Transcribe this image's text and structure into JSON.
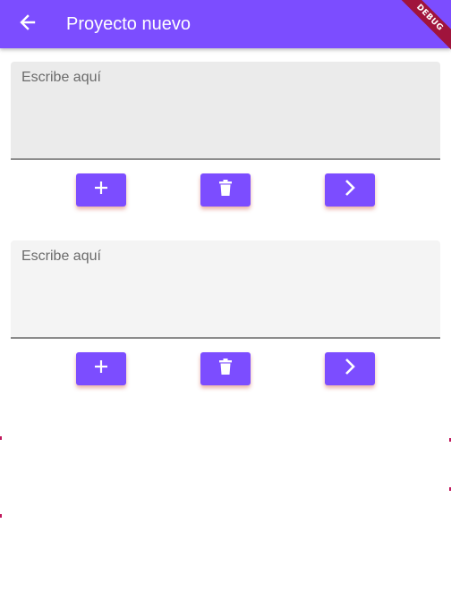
{
  "appbar": {
    "title": "Proyecto nuevo",
    "back_icon": "arrow-back-icon",
    "debug_label": "DEBUG",
    "color": "#7c4dff"
  },
  "fields": [
    {
      "placeholder": "Escribe aquí",
      "state": "focused"
    },
    {
      "placeholder": "Escribe aquí",
      "state": "idle"
    }
  ],
  "actions": {
    "add_icon": "plus-icon",
    "delete_icon": "trash-icon",
    "next_icon": "chevron-right-icon",
    "button_color": "#7c4dff"
  }
}
